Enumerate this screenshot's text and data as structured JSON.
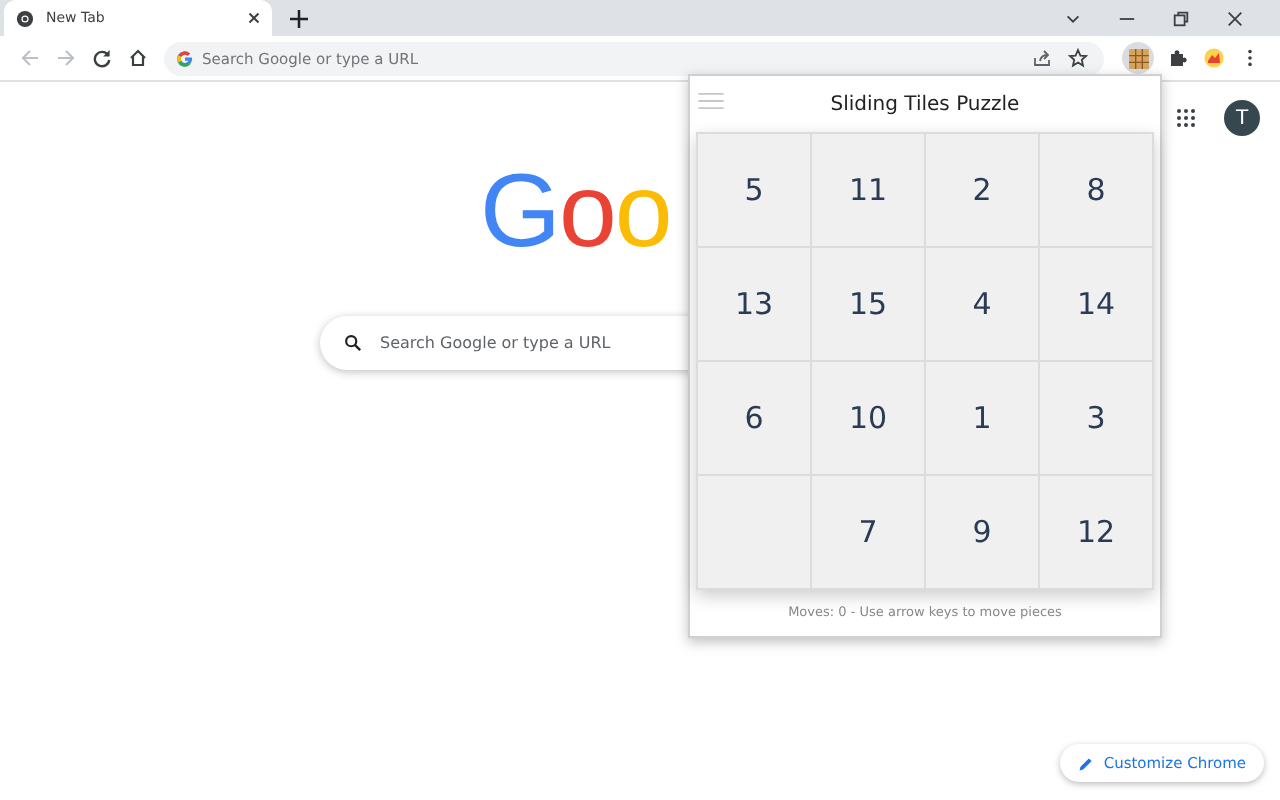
{
  "tab": {
    "title": "New Tab",
    "selected": true
  },
  "omnibox": {
    "placeholder": "Search Google or type a URL"
  },
  "logo": [
    {
      "letter": "G",
      "color": "#4285f4"
    },
    {
      "letter": "o",
      "color": "#ea4335"
    },
    {
      "letter": "o",
      "color": "#fbbc05"
    }
  ],
  "search": {
    "placeholder": "Search Google or type a URL"
  },
  "account": {
    "initial": "T"
  },
  "popup": {
    "title": "Sliding Tiles Puzzle",
    "status": "Moves: 0 - Use arrow keys to move pieces",
    "tiles": [
      {
        "kind": "number",
        "label": "5"
      },
      {
        "kind": "number",
        "label": "11"
      },
      {
        "kind": "number",
        "label": "2"
      },
      {
        "kind": "number",
        "label": "8"
      },
      {
        "kind": "number",
        "label": "13"
      },
      {
        "kind": "number",
        "label": "15"
      },
      {
        "kind": "number",
        "label": "4"
      },
      {
        "kind": "number",
        "label": "14"
      },
      {
        "kind": "number",
        "label": "6"
      },
      {
        "kind": "number",
        "label": "10"
      },
      {
        "kind": "number",
        "label": "1"
      },
      {
        "kind": "number",
        "label": "3"
      },
      {
        "kind": "empty"
      },
      {
        "kind": "number",
        "label": "7"
      },
      {
        "kind": "number",
        "label": "9"
      },
      {
        "kind": "number",
        "label": "12"
      }
    ]
  },
  "customize_button": {
    "label": "Customize Chrome"
  }
}
